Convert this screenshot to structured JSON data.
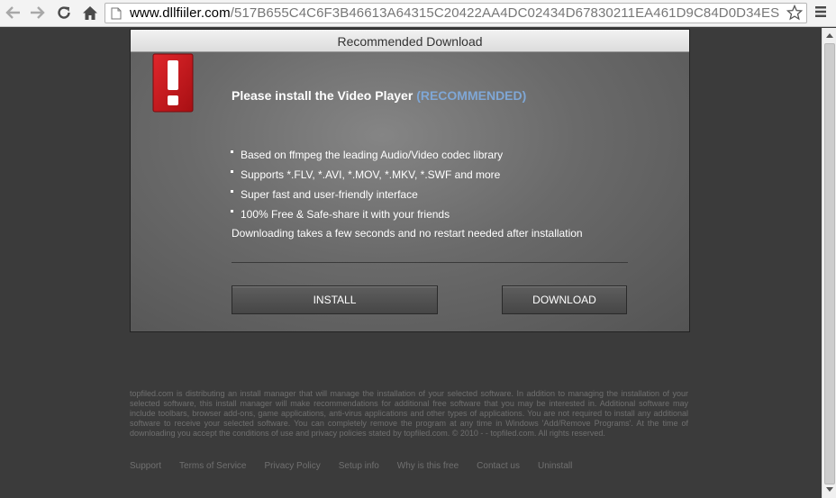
{
  "browser": {
    "url_domain": "www.dllfiiler.com",
    "url_path": "/517B655C4C6F3B46613A64315C20422AA4DC02434D67830211EA461D9C84D0D34ES"
  },
  "dialog": {
    "title": "Recommended Download",
    "headline": "Please install the Video Player",
    "headline_tag": "(RECOMMENDED)",
    "features": [
      "Based on ffmpeg the leading Audio/Video codec library",
      "Supports *.FLV, *.AVI, *.MOV, *.MKV, *.SWF and more",
      "Super fast and user-friendly interface",
      "100% Free & Safe-share it with your friends"
    ],
    "note": "Downloading takes a few seconds and no restart needed after installation",
    "install_label": "INSTALL",
    "download_label": "DOWNLOAD"
  },
  "footer": {
    "disclaimer": "topfiled.com is distributing an install manager that will manage the installation of your selected software. In addition to managing the installation of your selected software, this install manager will make recommendations for additional free software that you may be interested in. Additional software may include toolbars, browser add-ons, game applications, anti-virus applications and other types of applications. You are not required to install any additional software to receive your selected software. You can completely remove the program at any time in Windows 'Add/Remove Programs'. At the time of downloading you accept the conditions of use and privacy policies stated by topfiled.com. © 2010 - - topfiled.com. All rights reserved.",
    "links": [
      "Support",
      "Terms of Service",
      "Privacy Policy",
      "Setup info",
      "Why is this free",
      "Contact us",
      "Uninstall"
    ]
  },
  "colors": {
    "accent": "#7fa7d6",
    "alert_red": "#c4161c",
    "page_bg": "#3b3b3b"
  },
  "icons": [
    "back-icon",
    "forward-icon",
    "reload-icon",
    "home-icon",
    "page-icon",
    "star-icon",
    "menu-icon",
    "alert-icon"
  ]
}
